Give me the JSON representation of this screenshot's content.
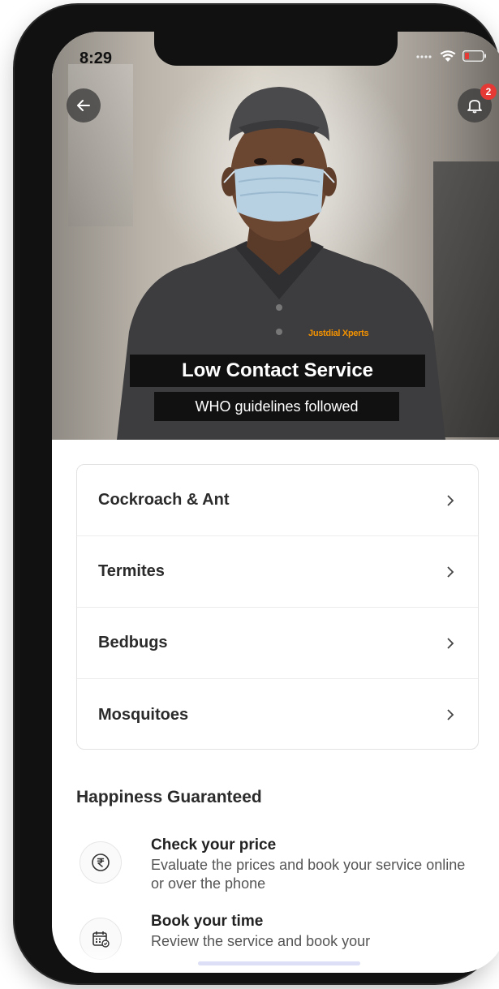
{
  "status_bar": {
    "time": "8:29"
  },
  "header": {
    "notification_count": "2"
  },
  "banner": {
    "title": "Low Contact Service",
    "subtitle": "WHO guidelines followed",
    "shirt_logo": "Justdial Xperts"
  },
  "services": [
    {
      "label": "Cockroach & Ant"
    },
    {
      "label": "Termites"
    },
    {
      "label": "Bedbugs"
    },
    {
      "label": "Mosquitoes"
    }
  ],
  "happiness": {
    "title": "Happiness Guaranteed",
    "items": [
      {
        "title": "Check your price",
        "description": "Evaluate the prices and book your service online or over the phone",
        "icon": "rupee-icon"
      },
      {
        "title": "Book your time",
        "description": "Review the service and book your",
        "icon": "calendar-icon"
      }
    ]
  },
  "colors": {
    "badge": "#e53935",
    "accent_orange": "#f39200",
    "accent_blue": "#1e88e5"
  }
}
